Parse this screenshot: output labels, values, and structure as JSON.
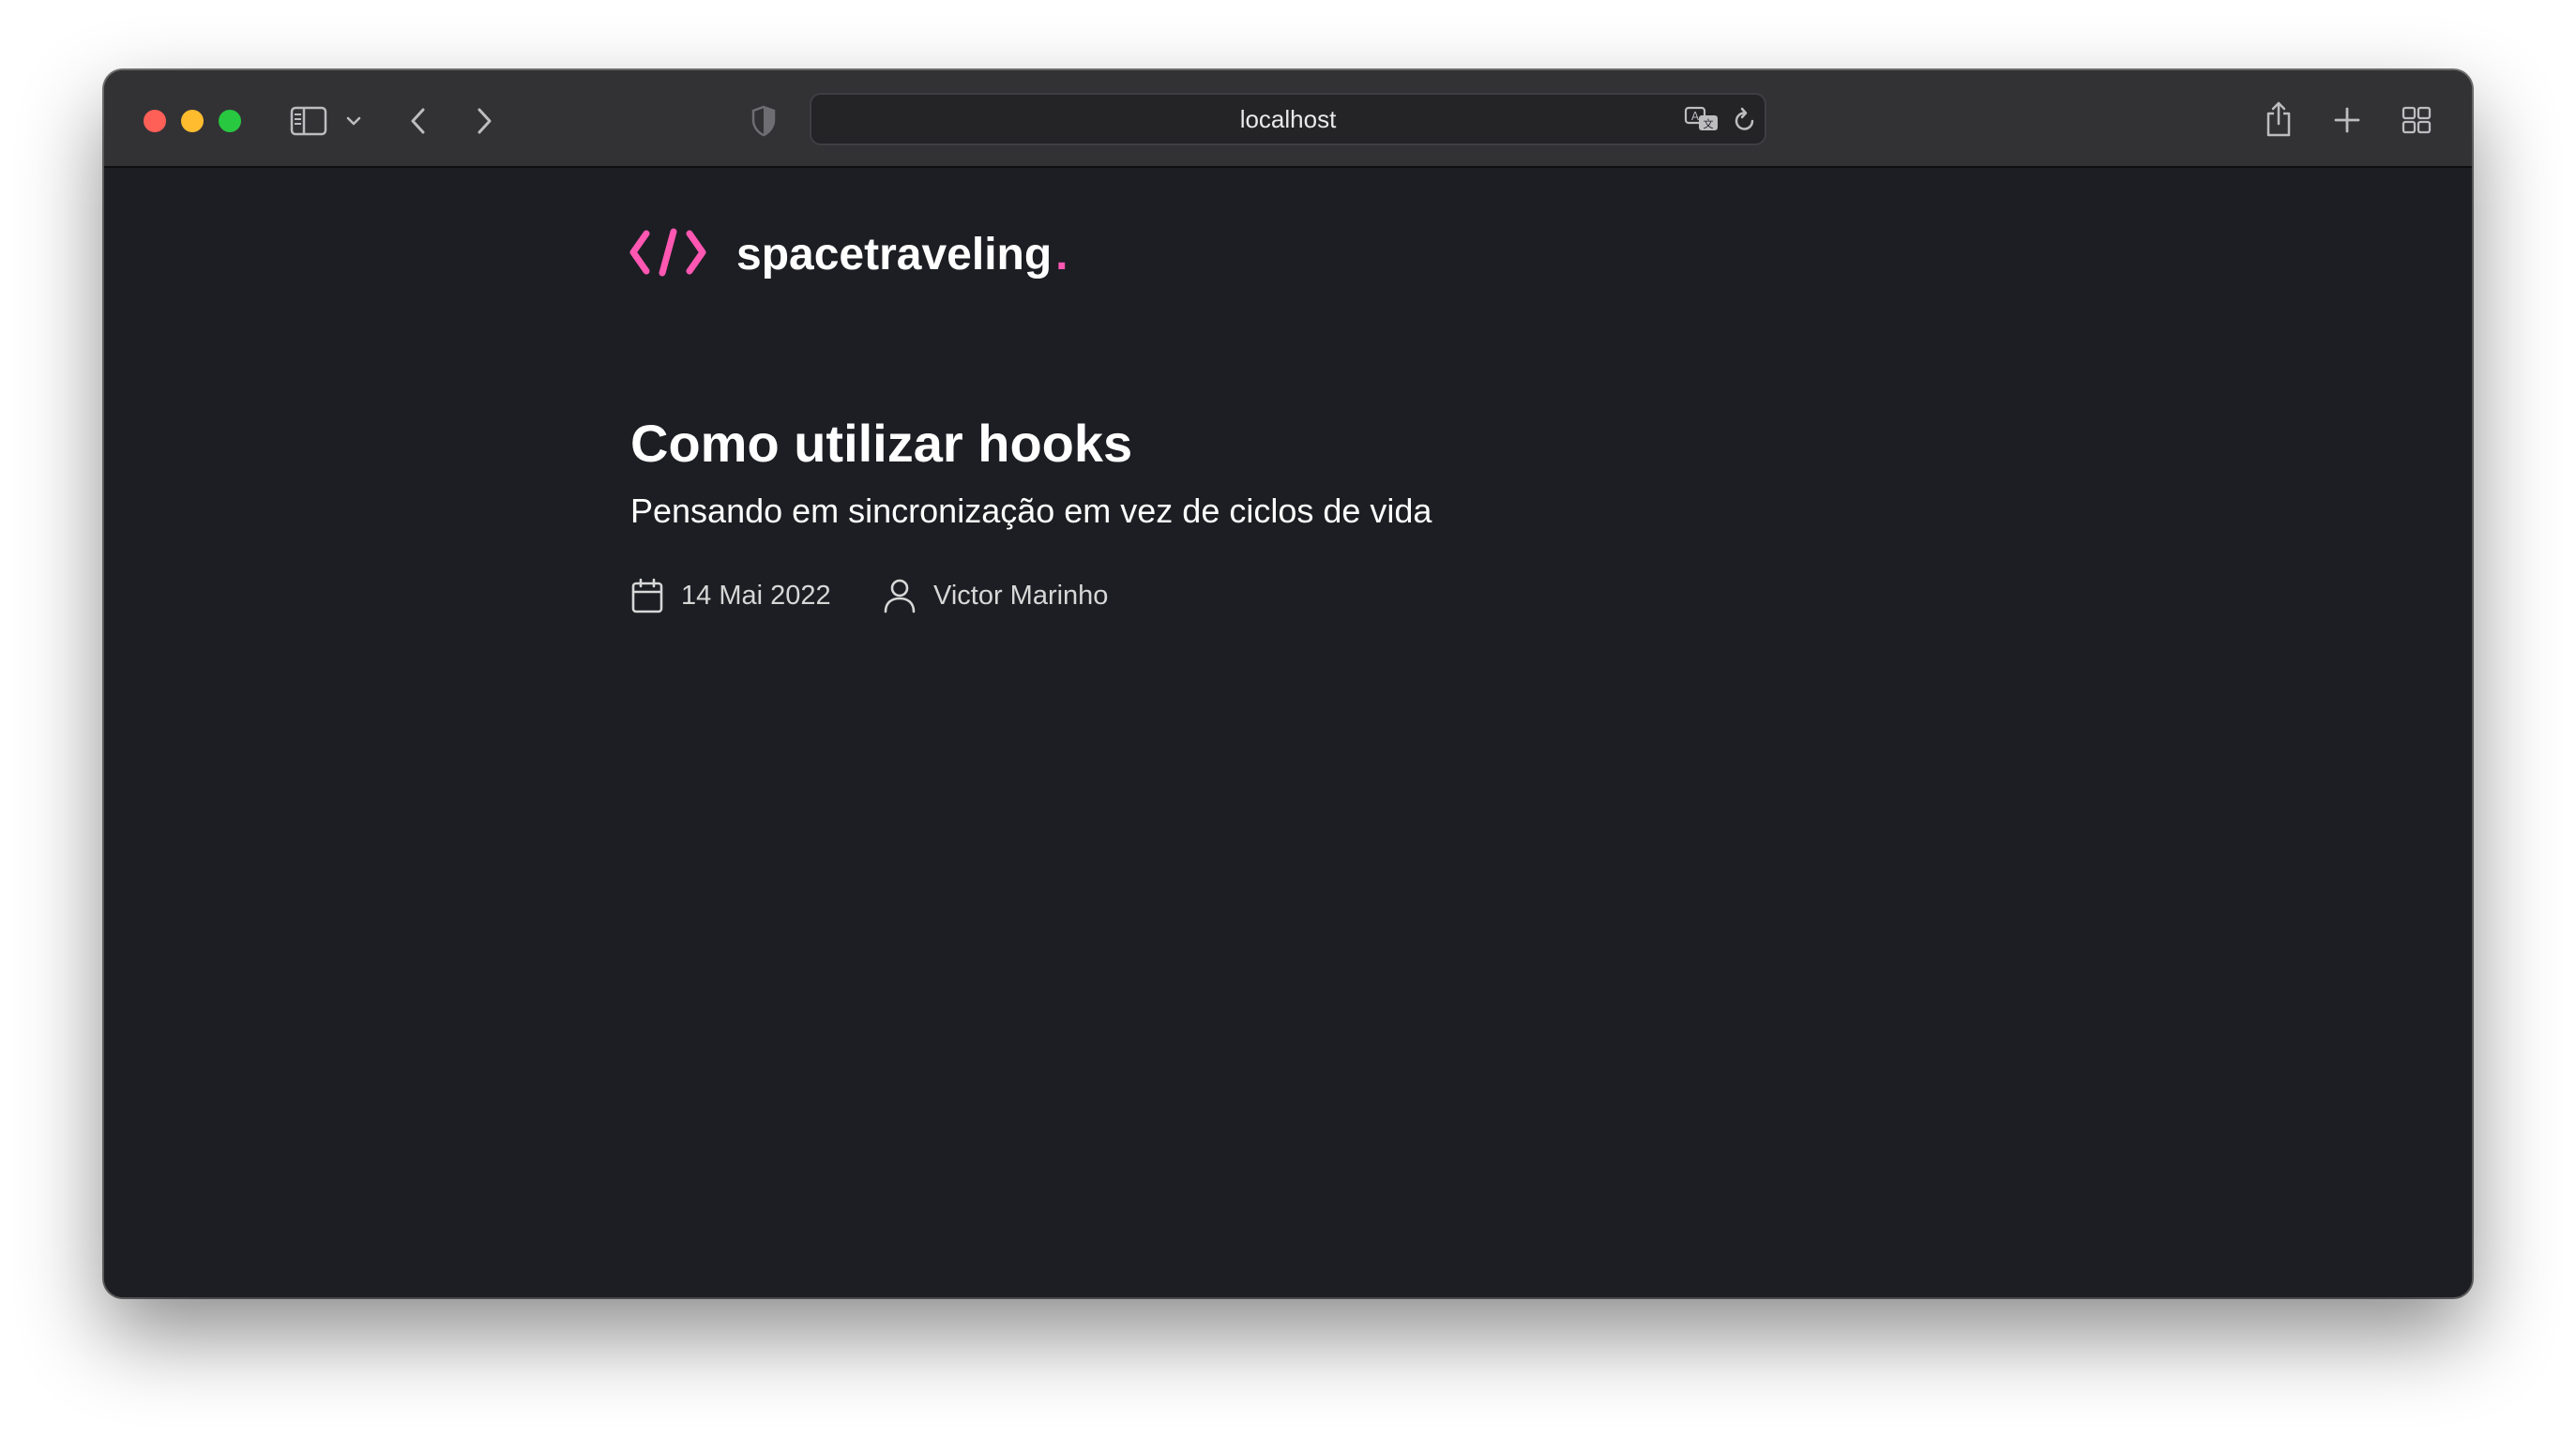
{
  "browser": {
    "url": "localhost",
    "icons": {
      "sidebar": "sidebar-icon",
      "sidebar_menu": "chevron-down-icon",
      "back": "chevron-left-icon",
      "forward": "chevron-right-icon",
      "privacy": "shield-icon",
      "translate": "translate-icon",
      "reload": "reload-icon",
      "share": "share-icon",
      "new_tab": "plus-icon",
      "tab_overview": "grid-icon"
    },
    "traffic_lights": {
      "close": "#fe5f57",
      "minimize": "#febc2e",
      "zoom": "#28c840"
    }
  },
  "site": {
    "logo_icon": "code-brackets-icon",
    "name": "spacetraveling",
    "name_dot": ".",
    "accent_color": "#ff57b2"
  },
  "post": {
    "title": "Como utilizar hooks",
    "subtitle": "Pensando em sincronização em vez de ciclos de vida",
    "date": "14 Mai 2022",
    "author": "Victor Marinho",
    "date_icon": "calendar-icon",
    "author_icon": "user-icon"
  }
}
